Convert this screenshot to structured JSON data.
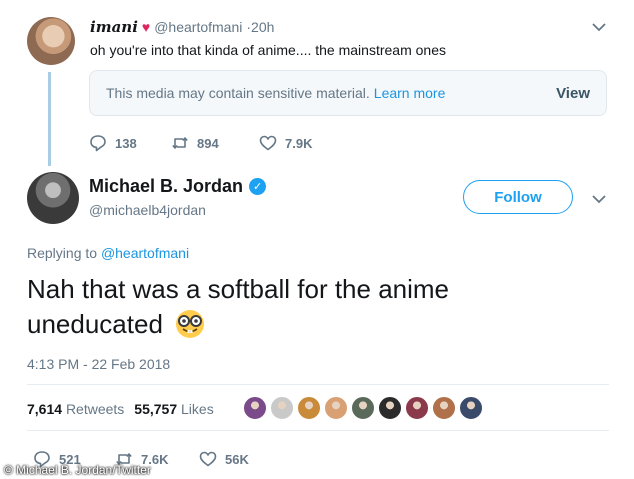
{
  "parent_tweet": {
    "name": "imani",
    "handle": "@heartofmani",
    "time": "·20h",
    "text": "oh you're into that kinda of anime.... the mainstream ones",
    "media_notice": "This media may contain sensitive material.",
    "learn_more": "Learn more",
    "view_label": "View",
    "replies": "138",
    "retweets": "894",
    "likes": "7.9K"
  },
  "main_tweet": {
    "name": "Michael B. Jordan",
    "handle": "@michaelb4jordan",
    "follow_label": "Follow",
    "replying_prefix": "Replying to",
    "replying_handle": "@heartofmani",
    "text": "Nah that was a softball for the anime uneducated",
    "timestamp": "4:13 PM - 22 Feb 2018",
    "retweet_count": "7,614",
    "retweet_label": "Retweets",
    "like_count": "55,757",
    "like_label": "Likes",
    "liker_colors": [
      "#7a4a8a",
      "#c9c9c9",
      "#c98a3a",
      "#d9a074",
      "#5a6a5a",
      "#2b2b2b",
      "#8a3a4a",
      "#b0704a",
      "#3a4a6a"
    ],
    "replies": "521",
    "retweets": "7.6K",
    "likes": "56K"
  },
  "credit": "© Michael B. Jordan/Twitter",
  "colors": {
    "accent": "#1da1f2",
    "heart": "#e0245e",
    "muted": "#657786"
  }
}
